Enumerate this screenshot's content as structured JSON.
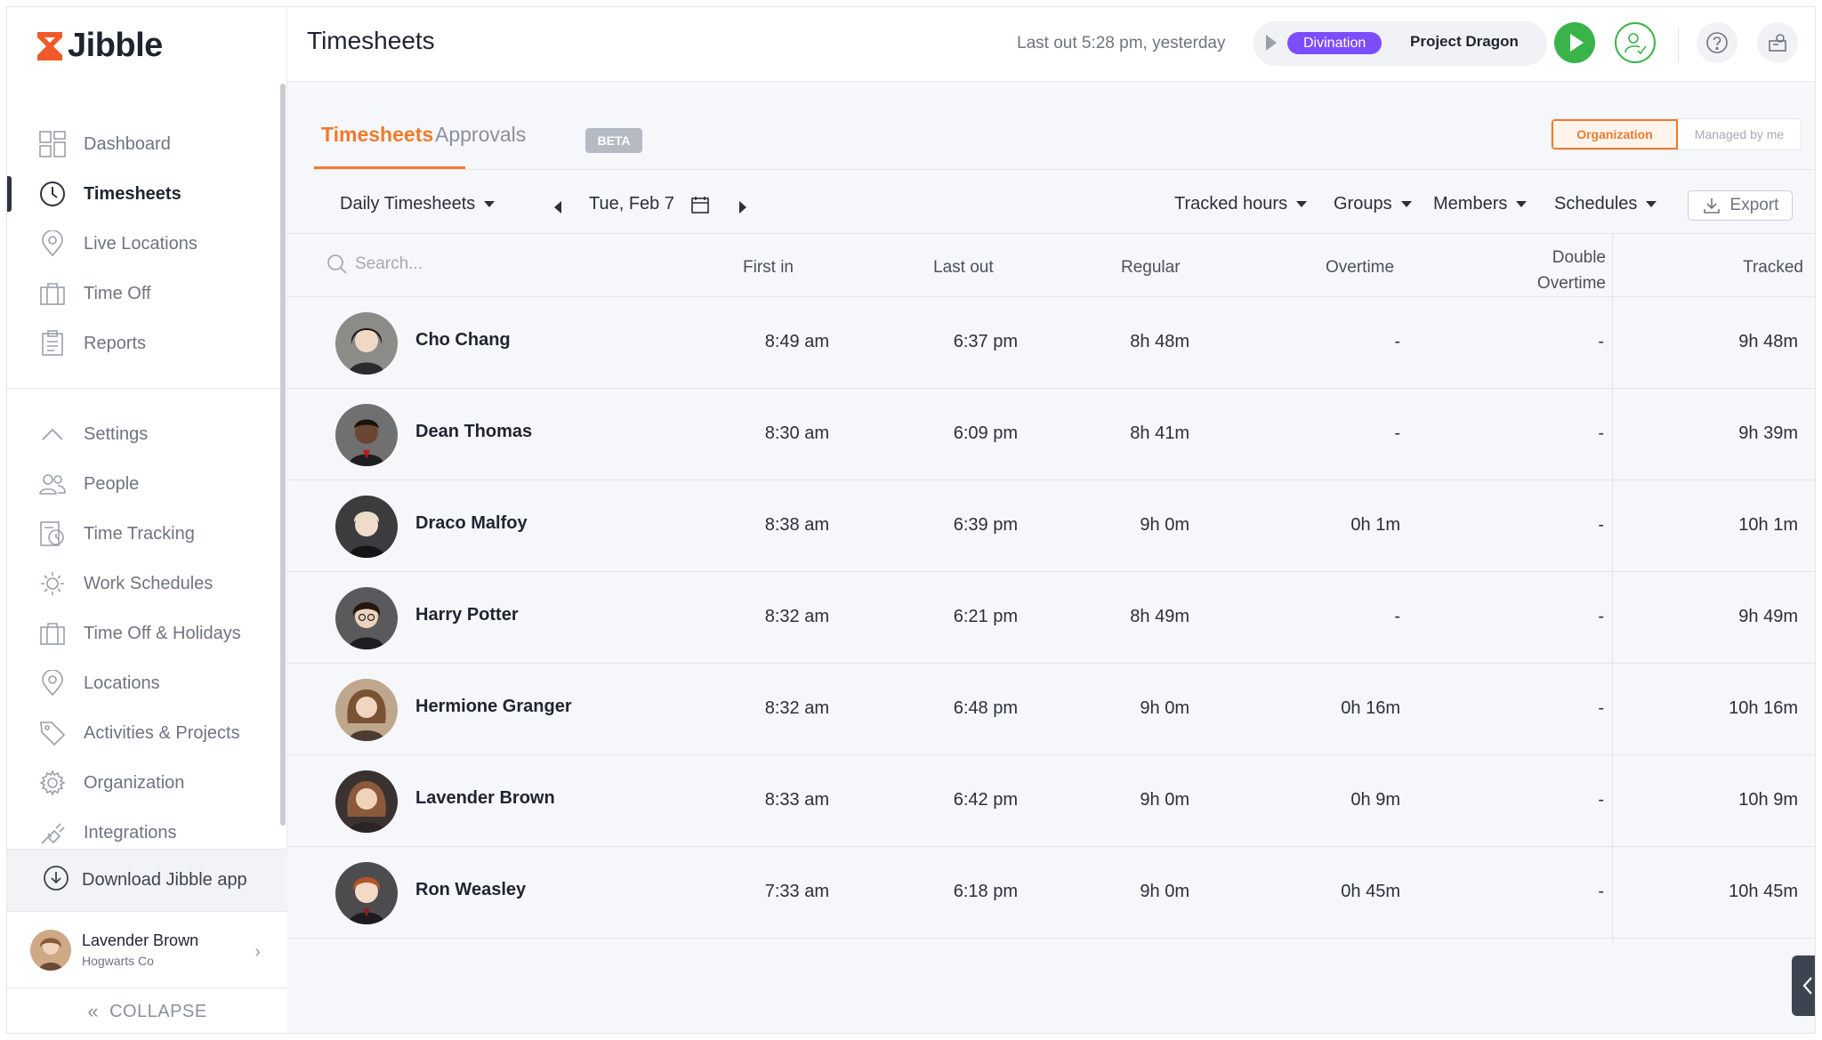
{
  "app": {
    "name": "Jibble"
  },
  "colors": {
    "accent": "#f07a2e",
    "activity": "#7c4dff",
    "play": "#3ab44a"
  },
  "sidebar": {
    "primary": [
      {
        "label": "Dashboard",
        "icon": "dashboard-icon",
        "active": false
      },
      {
        "label": "Timesheets",
        "icon": "clock-icon",
        "active": true
      },
      {
        "label": "Live Locations",
        "icon": "location-pin-icon",
        "active": false
      },
      {
        "label": "Time Off",
        "icon": "briefcase-icon",
        "active": false
      },
      {
        "label": "Reports",
        "icon": "clipboard-icon",
        "active": false
      }
    ],
    "secondary": [
      {
        "label": "Settings",
        "icon": "chevron-up-icon"
      },
      {
        "label": "People",
        "icon": "people-icon"
      },
      {
        "label": "Time Tracking",
        "icon": "time-tracking-icon"
      },
      {
        "label": "Work Schedules",
        "icon": "sun-schedule-icon"
      },
      {
        "label": "Time Off & Holidays",
        "icon": "briefcase-icon"
      },
      {
        "label": "Locations",
        "icon": "location-pin-icon"
      },
      {
        "label": "Activities & Projects",
        "icon": "tag-icon"
      },
      {
        "label": "Organization",
        "icon": "gear-icon"
      },
      {
        "label": "Integrations",
        "icon": "plug-icon"
      }
    ],
    "download_label": "Download Jibble app",
    "user": {
      "name": "Lavender Brown",
      "company": "Hogwarts Co"
    },
    "collapse_label": "COLLAPSE"
  },
  "topbar": {
    "title": "Timesheets",
    "last_out": "Last out 5:28 pm, yesterday",
    "activity": "Divination",
    "project": "Project Dragon"
  },
  "tabs": {
    "timesheets": "Timesheets",
    "approvals": "Approvals",
    "beta": "BETA",
    "scope_org": "Organization",
    "scope_managed": "Managed by me"
  },
  "filters": {
    "view": "Daily Timesheets",
    "date": "Tue, Feb 7",
    "tracked": "Tracked hours",
    "groups": "Groups",
    "members": "Members",
    "schedules": "Schedules",
    "export": "Export"
  },
  "table": {
    "search_placeholder": "Search...",
    "headers": {
      "first_in": "First in",
      "last_out": "Last out",
      "regular": "Regular",
      "overtime": "Overtime",
      "double_1": "Double",
      "double_2": "Overtime",
      "tracked": "Tracked"
    },
    "rows": [
      {
        "name": "Cho Chang",
        "first_in": "8:49 am",
        "last_out": "6:37 pm",
        "regular": "8h 48m",
        "overtime": "-",
        "double": "-",
        "tracked": "9h 48m"
      },
      {
        "name": "Dean Thomas",
        "first_in": "8:30 am",
        "last_out": "6:09 pm",
        "regular": "8h 41m",
        "overtime": "-",
        "double": "-",
        "tracked": "9h 39m"
      },
      {
        "name": "Draco Malfoy",
        "first_in": "8:38 am",
        "last_out": "6:39 pm",
        "regular": "9h 0m",
        "overtime": "0h 1m",
        "double": "-",
        "tracked": "10h 1m"
      },
      {
        "name": "Harry Potter",
        "first_in": "8:32 am",
        "last_out": "6:21 pm",
        "regular": "8h 49m",
        "overtime": "-",
        "double": "-",
        "tracked": "9h 49m"
      },
      {
        "name": "Hermione Granger",
        "first_in": "8:32 am",
        "last_out": "6:48 pm",
        "regular": "9h 0m",
        "overtime": "0h 16m",
        "double": "-",
        "tracked": "10h 16m"
      },
      {
        "name": "Lavender Brown",
        "first_in": "8:33 am",
        "last_out": "6:42 pm",
        "regular": "9h 0m",
        "overtime": "0h 9m",
        "double": "-",
        "tracked": "10h 9m"
      },
      {
        "name": "Ron Weasley",
        "first_in": "7:33 am",
        "last_out": "6:18 pm",
        "regular": "9h 0m",
        "overtime": "0h 45m",
        "double": "-",
        "tracked": "10h 45m"
      }
    ]
  }
}
